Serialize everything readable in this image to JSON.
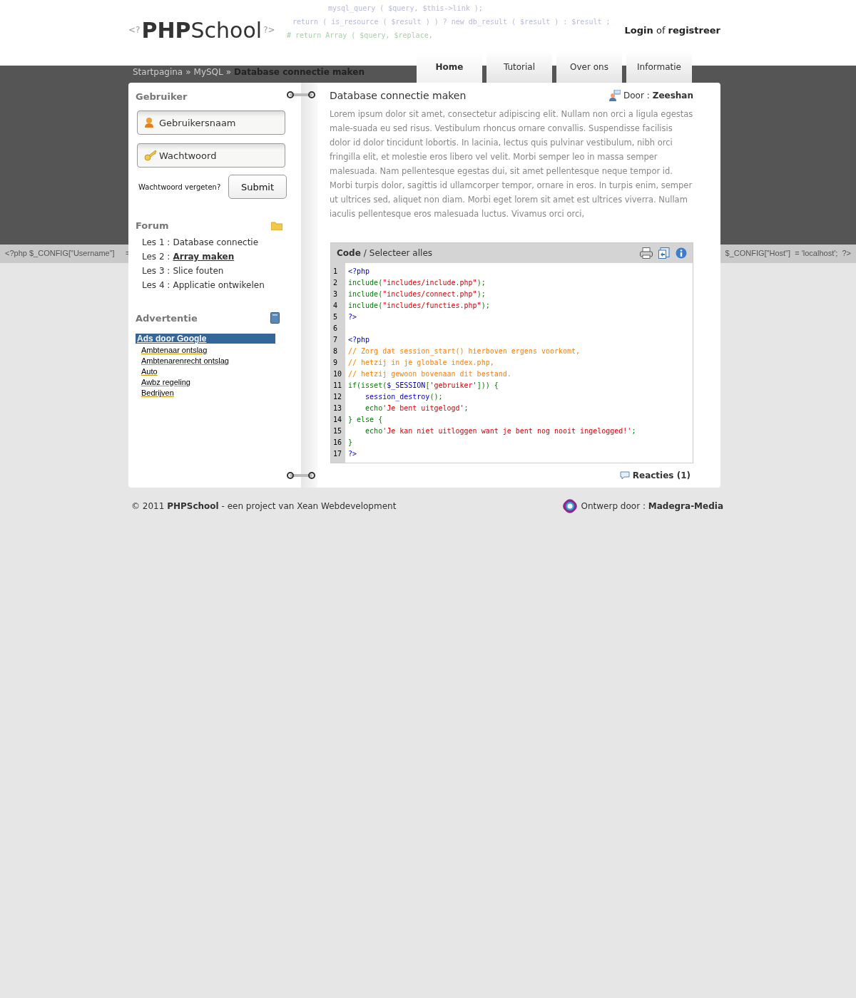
{
  "header": {
    "logo": {
      "open": "<?",
      "bold": "PHP",
      "rest": "School",
      "close": "?>"
    },
    "background_code": [
      "mysql_query ( $query, $this->link );",
      "return ( is_resource ( $result ) ) ? new db_result ( $result ) : $result ;",
      "# return Array ( $query, $replace,"
    ],
    "login": "**Login** of **registreer**"
  },
  "breadcrumb": {
    "separator": "»",
    "items": [
      "Startpagina",
      "MySQL",
      "Database connectie maken"
    ]
  },
  "tabs": [
    {
      "label": "Home",
      "selected": true
    },
    {
      "label": "Tutorial",
      "selected": false
    },
    {
      "label": "Over ons",
      "selected": false
    },
    {
      "label": "Informatie",
      "selected": false
    }
  ],
  "config_strip": {
    "left": "<?php $_CONFIG[\"Username\"]     =",
    "right": "$_CONFIG[\"Host\"]  = 'localhost';  ?>"
  },
  "sidebar": {
    "user": {
      "title": "Gebruiker",
      "username_placeholder": "Gebruikersnaam",
      "password_placeholder": "Wachtwoord",
      "forgot": "Wachtwoord vergeten?",
      "submit": "Submit"
    },
    "forum": {
      "title": "Forum",
      "items": [
        {
          "prefix": "Les 1 :",
          "title": "Database connectie",
          "selected": false
        },
        {
          "prefix": "Les 2 :",
          "title": "Array maken",
          "selected": true
        },
        {
          "prefix": "Les 3 :",
          "title": "Slice fouten",
          "selected": false
        },
        {
          "prefix": "Les 4 :",
          "title": "Applicatie ontwikelen",
          "selected": false
        }
      ]
    },
    "ads": {
      "title": "Advertentie",
      "heading": "Ads door Google",
      "links": [
        "Ambtenaar ontslag",
        "Ambtenarenrecht ontslag",
        "Auto",
        "Awbz regeling",
        "Bedrijven"
      ]
    }
  },
  "article": {
    "title": "Database connectie maken",
    "author_label": "Door :",
    "author": "Zeeshan",
    "body": "Lorem ipsum dolor sit amet, consectetur adipiscing elit. Nullam non orci a ligula egestas male-suada eu sed risus. Vestibulum rhoncus ornare convallis. Suspendisse facilisis dolor id dolor tincidunt lobortis. In lacinia, lectus quis pulvinar vestibulum, nibh orci fringilla elit, et molestie eros libero vel velit. Morbi semper leo in massa semper malesuada. Nam pellentesque egestas dui, sit amet pellentesque neque tempor id. Morbi turpis dolor, sagittis id ullamcorper tempor, ornare in eros. In turpis enim, semper ut ultrices sed, aliquet non diam. Morbi eget lorem sit amet est ultrices viverra. Nullam iaculis pellentesque eros malesuada luctus. Vivamus orci orci,",
    "code": {
      "title": "Code",
      "separator": "/",
      "select_all": "Selecteer alles",
      "lines": [
        {
          "number": "1",
          "segments": [
            {
              "kind": "tag",
              "text": "<?php"
            }
          ]
        },
        {
          "number": "2",
          "segments": [
            {
              "kind": "fn",
              "text": "include("
            },
            {
              "kind": "str",
              "text": "\"includes/include.php\""
            },
            {
              "kind": "fn",
              "text": ");"
            }
          ]
        },
        {
          "number": "3",
          "segments": [
            {
              "kind": "fn",
              "text": "include("
            },
            {
              "kind": "str",
              "text": "\"includes/connect.php\""
            },
            {
              "kind": "fn",
              "text": ");"
            }
          ]
        },
        {
          "number": "4",
          "segments": [
            {
              "kind": "fn",
              "text": "include("
            },
            {
              "kind": "str",
              "text": "\"includes/functies.php\""
            },
            {
              "kind": "fn",
              "text": ");"
            }
          ]
        },
        {
          "number": "5",
          "segments": [
            {
              "kind": "tag",
              "text": "?>"
            }
          ]
        },
        {
          "number": "6"
        },
        {
          "number": "7",
          "segments": [
            {
              "kind": "tag",
              "text": "<?php"
            }
          ]
        },
        {
          "number": "8",
          "segments": [
            {
              "kind": "comment",
              "text": "// Zorg dat session_start() hierboven ergens voorkomt,"
            }
          ]
        },
        {
          "number": "9",
          "segments": [
            {
              "kind": "comment",
              "text": "// hetzij in je globale index.php,"
            }
          ]
        },
        {
          "number": "10",
          "segments": [
            {
              "kind": "comment",
              "text": "// hetzij gewoon bovenaan dit bestand."
            }
          ]
        },
        {
          "number": "11",
          "segments": [
            {
              "kind": "fn",
              "text": "if(isset("
            },
            {
              "kind": "tag",
              "text": "$_SESSION"
            },
            {
              "kind": "fn",
              "text": "["
            },
            {
              "kind": "str",
              "text": "'gebruiker'"
            },
            {
              "kind": "fn",
              "text": "])) {"
            }
          ]
        },
        {
          "number": "12",
          "segments": [
            {
              "kind": "tag",
              "text": "    session_destroy"
            },
            {
              "kind": "fn",
              "text": "();"
            }
          ]
        },
        {
          "number": "13",
          "segments": [
            {
              "kind": "fn",
              "text": "    echo"
            },
            {
              "kind": "str",
              "text": "'Je bent uitgelogd'"
            },
            {
              "kind": "fn",
              "text": ";"
            }
          ]
        },
        {
          "number": "14",
          "segments": [
            {
              "kind": "fn",
              "text": "} else {"
            }
          ]
        },
        {
          "number": "15",
          "segments": [
            {
              "kind": "fn",
              "text": "    echo"
            },
            {
              "kind": "str",
              "text": "'Je kan niet uitloggen want je bent nog nooit ingelogged!'"
            },
            {
              "kind": "fn",
              "text": ";"
            }
          ]
        },
        {
          "number": "16",
          "segments": [
            {
              "kind": "fn",
              "text": "}"
            }
          ]
        },
        {
          "number": "17",
          "segments": [
            {
              "kind": "tag",
              "text": "?>"
            }
          ]
        }
      ]
    },
    "comments": "Reacties (1)"
  },
  "footer": {
    "copyright": "© 2011 **PHPSchool** - een project van Xean Webdevelopment",
    "design": "Ontwerp door : **Madegra-Media**"
  }
}
